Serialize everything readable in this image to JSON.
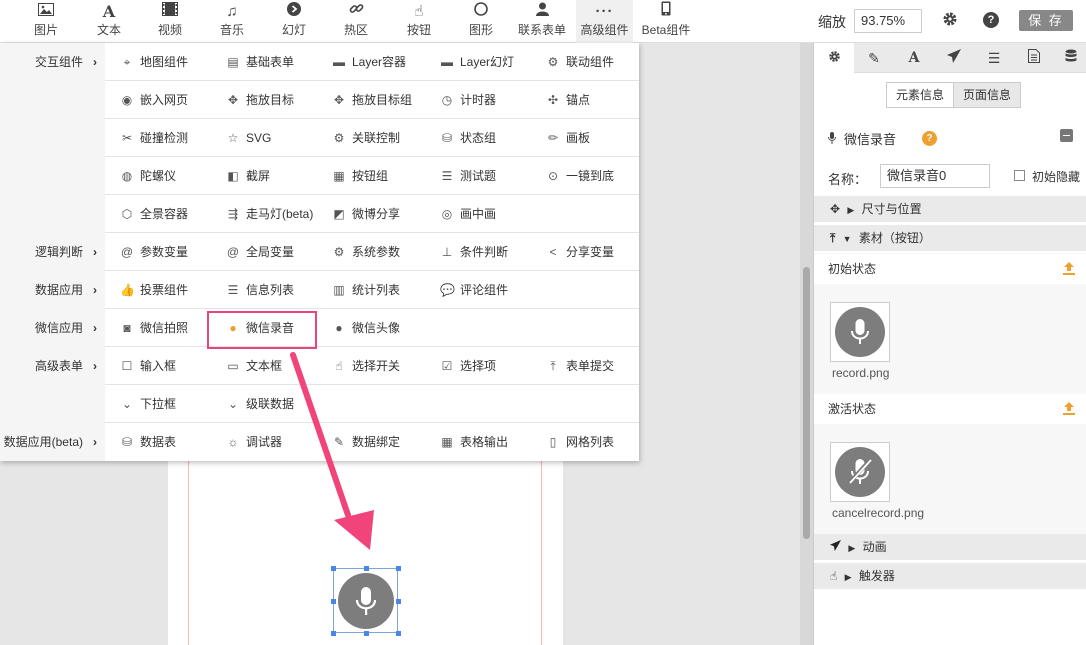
{
  "toolbar": {
    "items": [
      {
        "label": "图片",
        "icon": "image-icon"
      },
      {
        "label": "文本",
        "icon": "text-icon"
      },
      {
        "label": "视频",
        "icon": "video-icon"
      },
      {
        "label": "音乐",
        "icon": "music-icon"
      },
      {
        "label": "幻灯",
        "icon": "slideshow-icon"
      },
      {
        "label": "热区",
        "icon": "link-icon"
      },
      {
        "label": "按钮",
        "icon": "pointer-icon"
      },
      {
        "label": "图形",
        "icon": "circle-icon"
      },
      {
        "label": "联系表单",
        "icon": "user-icon"
      },
      {
        "label": "高级组件",
        "icon": "more-icon"
      },
      {
        "label": "Beta组件",
        "icon": "mobile-icon"
      }
    ],
    "zoom_label": "缩放",
    "zoom_value": "93.75%",
    "save_label": "保 存"
  },
  "menu": {
    "rows": [
      {
        "category": "交互组件",
        "items": [
          "地图组件",
          "基础表单",
          "Layer容器",
          "Layer幻灯",
          "联动组件"
        ]
      },
      {
        "category": "",
        "items": [
          "嵌入网页",
          "拖放目标",
          "拖放目标组",
          "计时器",
          "锚点"
        ]
      },
      {
        "category": "",
        "items": [
          "碰撞检测",
          "SVG",
          "关联控制",
          "状态组",
          "画板"
        ]
      },
      {
        "category": "",
        "items": [
          "陀螺仪",
          "截屏",
          "按钮组",
          "测试题",
          "一镜到底"
        ]
      },
      {
        "category": "",
        "items": [
          "全景容器",
          "走马灯(beta)",
          "微博分享",
          "画中画"
        ]
      },
      {
        "category": "逻辑判断",
        "items": [
          "参数变量",
          "全局变量",
          "系统参数",
          "条件判断",
          "分享变量"
        ]
      },
      {
        "category": "数据应用",
        "items": [
          "投票组件",
          "信息列表",
          "统计列表",
          "评论组件"
        ]
      },
      {
        "category": "微信应用",
        "items": [
          "微信拍照",
          "微信录音",
          "微信头像"
        ]
      },
      {
        "category": "高级表单",
        "items": [
          "输入框",
          "文本框",
          "选择开关",
          "选择项",
          "表单提交"
        ]
      },
      {
        "category": "",
        "items": [
          "下拉框",
          "级联数据"
        ]
      },
      {
        "category": "数据应用(beta)",
        "items": [
          "数据表",
          "调试器",
          "数据绑定",
          "表格输出",
          "网格列表"
        ]
      }
    ],
    "arrow": "›"
  },
  "panel": {
    "subtabs": [
      "元素信息",
      "页面信息"
    ],
    "element_title": "微信录音",
    "help": "?",
    "name_label": "名称：",
    "name_value": "微信录音0",
    "hidden_label": "初始隐藏",
    "section_size": "尺寸与位置",
    "section_material": "素材（按钮）",
    "initial_state": "初始状态",
    "initial_file": "record.png",
    "active_state": "激活状态",
    "active_file": "cancelrecord.png",
    "section_animation": "动画",
    "section_trigger": "触发器"
  },
  "colors": {
    "highlight": "#e8457c",
    "arrow": "#f0447a",
    "upload": "#f0a030",
    "selection": "#4a86e8"
  }
}
